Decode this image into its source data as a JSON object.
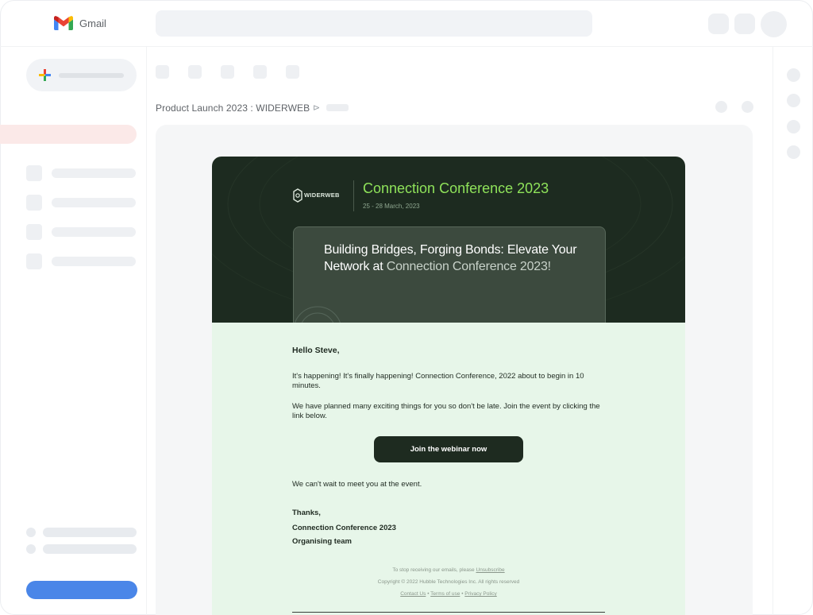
{
  "header": {
    "app_name": "Gmail",
    "brand_colors": [
      "#ea4335",
      "#4285f4",
      "#34a853",
      "#fbbc04"
    ]
  },
  "sidebar": {
    "compose_colors": [
      "#ea4335",
      "#4285f4",
      "#34a853",
      "#fbbc04"
    ]
  },
  "message": {
    "subject": "Product Launch 2023 : WIDERWEB",
    "label_icon": "label-icon"
  },
  "email": {
    "brand": "WIDERWEB",
    "conference_title": "Connection Conference 2023",
    "conference_date": "25 - 28 March, 2023",
    "hero_heading_bold": "Building Bridges, Forging Bonds: Elevate Your Network at",
    "hero_heading_light": "Connection Conference 2023!",
    "greeting": "Hello Steve,",
    "paragraph_1": "It's happening! It's finally happening! Connection Conference, 2022 about to begin in 10 minutes.",
    "paragraph_2": "We have planned many exciting things for you so don't be late. Join the event by clicking the link below.",
    "cta_label": "Join the webinar now",
    "paragraph_3": "We can't wait to meet you at the event.",
    "sign_off": "Thanks,",
    "signature_line_1": "Connection Conference 2023",
    "signature_line_2": "Organising team",
    "footer_unsubscribe_prefix": "To stop receiving our emails, please",
    "footer_unsubscribe_link": "Unsubscribe",
    "footer_copyright": "Copyright © 2022 Hubble Technologies Inc. All rights reserved",
    "footer_link_contact": "Contact Us",
    "footer_link_terms": "Terms of use",
    "footer_link_privacy": "Privacy Policy",
    "accent_color": "#8fe35a",
    "hero_background": "#1d2b20",
    "body_background": "#e7f6e9"
  }
}
